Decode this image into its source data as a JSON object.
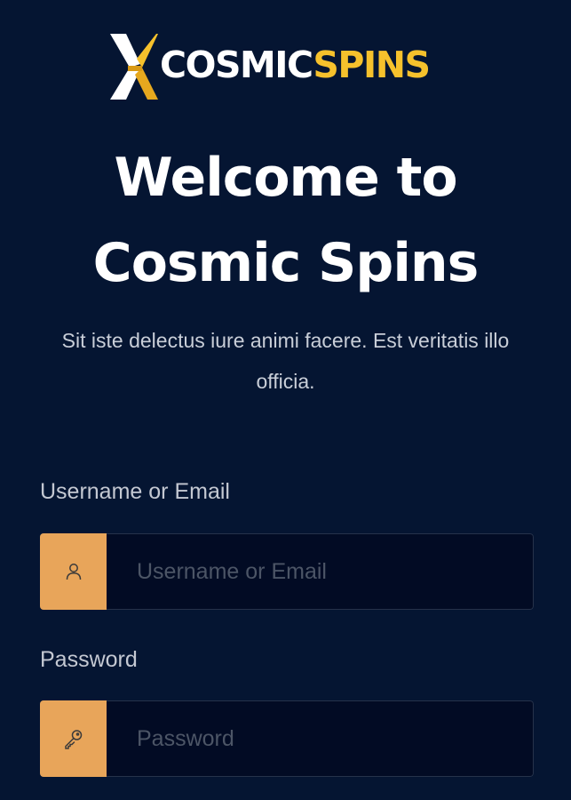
{
  "brand": {
    "logo_text_white": "COSMIC",
    "logo_text_yellow": "SPINS",
    "accent_yellow": "#f6c12c",
    "background": "#051532"
  },
  "hero": {
    "title_line1": "Welcome to",
    "title_line2": "Cosmic Spins",
    "subtitle": "Sit iste delectus iure animi facere. Est veritatis illo officia."
  },
  "form": {
    "username": {
      "label": "Username or Email",
      "placeholder": "Username or Email",
      "value": "",
      "icon": "user-icon"
    },
    "password": {
      "label": "Password",
      "placeholder": "Password",
      "value": "",
      "icon": "key-icon"
    },
    "icon_box_color": "#e8a55a"
  }
}
